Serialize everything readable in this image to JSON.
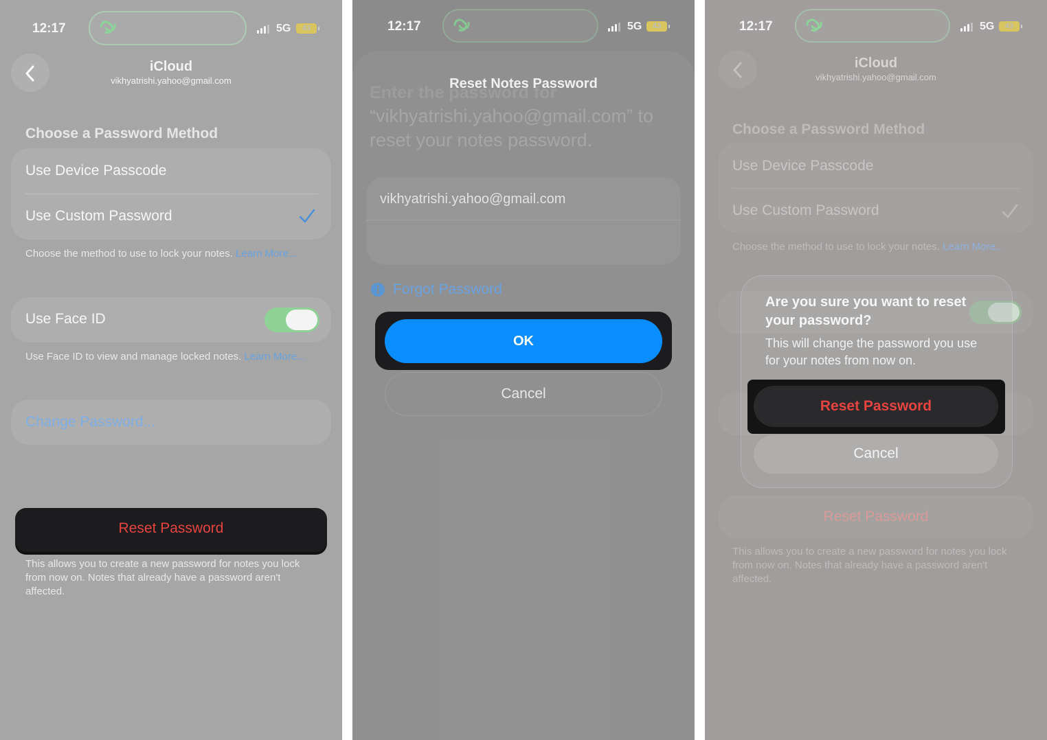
{
  "status_bar": {
    "time": "12:17",
    "network": "5G",
    "battery": "43"
  },
  "screen1": {
    "nav_title": "iCloud",
    "nav_subtitle": "vikhyatrishi.yahoo@gmail.com",
    "section_header": "Choose a Password Method",
    "option_device_passcode": "Use Device Passcode",
    "option_custom_password": "Use Custom Password",
    "method_footnote": "Choose the method to use to lock your notes.",
    "learn_more_1": "Learn More...",
    "face_id_label": "Use Face ID",
    "face_id_enabled": true,
    "face_id_footnote": "Use Face ID to view and manage locked notes.",
    "learn_more_2": "Learn More...",
    "change_password": "Change Password...",
    "reset_password": "Reset Password",
    "reset_footnote": "This allows you to create a new password for notes you lock from now on. Notes that already have a password aren't affected."
  },
  "screen2": {
    "sheet_title": "Reset Notes Password",
    "obscured_heading": "Enter the password for",
    "instruction": "“vikhyatrishi.yahoo@gmail.com” to reset your notes password.",
    "account_field": "vikhyatrishi.yahoo@gmail.com",
    "forgot_password": "Forgot Password",
    "ok_button": "OK",
    "cancel_button": "Cancel"
  },
  "screen3": {
    "nav_title": "iCloud",
    "nav_subtitle": "vikhyatrishi.yahoo@gmail.com",
    "section_header": "Choose a Password Method",
    "option_device_passcode": "Use Device Passcode",
    "option_custom_password": "Use Custom Password",
    "method_footnote": "Choose the method to use to lock your notes.",
    "learn_more": "Learn More...",
    "alert_title": "Are you sure you want to reset your password?",
    "alert_message": "This will change the password you use for your notes from now on.",
    "alert_reset": "Reset Password",
    "alert_cancel": "Cancel",
    "reset_password": "Reset Password",
    "reset_footnote": "This allows you to create a new password for notes you lock from now on. Notes that already have a password aren't affected."
  },
  "colors": {
    "accent_blue": "#0a8eff",
    "link_blue": "#6aa2e0",
    "destructive_red": "#e74341",
    "toggle_green": "#8fd296"
  },
  "icons": [
    "chevron-left-icon",
    "checkmark-icon",
    "info-icon",
    "signal-icon",
    "battery-icon",
    "app-link-icon"
  ]
}
